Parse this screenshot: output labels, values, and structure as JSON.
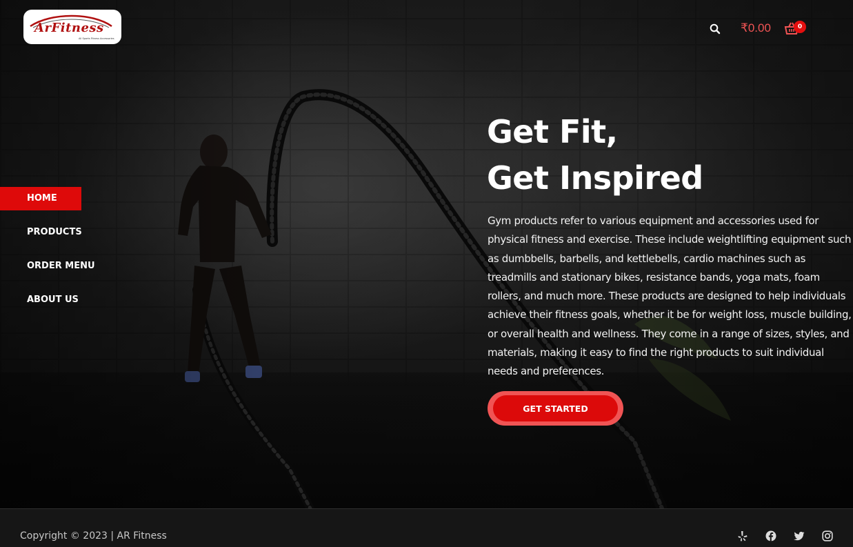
{
  "brand": {
    "logo_text": "ArFitness",
    "logo_tagline": "All Sports Fitness Accessories"
  },
  "header": {
    "cart_total": "₹0.00",
    "cart_count": "0"
  },
  "nav": {
    "items": [
      {
        "label": "HOME",
        "active": true
      },
      {
        "label": "PRODUCTS",
        "active": false
      },
      {
        "label": "ORDER MENU",
        "active": false
      },
      {
        "label": "ABOUT US",
        "active": false
      }
    ]
  },
  "hero": {
    "title_line1": "Get Fit,",
    "title_line2": "Get Inspired",
    "body": "Gym products refer to various equipment and accessories used for physical fitness and exercise. These include weightlifting equipment such as dumbbells, barbells, and kettlebells, cardio machines such as treadmills and stationary bikes, resistance bands, yoga mats, foam rollers, and much more. These products are designed to help individuals achieve their fitness goals, whether it be for weight loss, muscle building, or overall health and wellness. They come in a range of sizes, styles, and materials, making it easy to find the right products to suit individual needs and preferences.",
    "cta_label": "GET STARTED"
  },
  "footer": {
    "copyright": "Copyright © 2023 | AR Fitness",
    "social_icons": [
      "yelp-icon",
      "facebook-icon",
      "twitter-icon",
      "instagram-icon"
    ]
  },
  "colors": {
    "accent": "#de0a0a",
    "accent_light": "#f05454",
    "text": "#ffffff",
    "footer_bg": "#161616"
  }
}
